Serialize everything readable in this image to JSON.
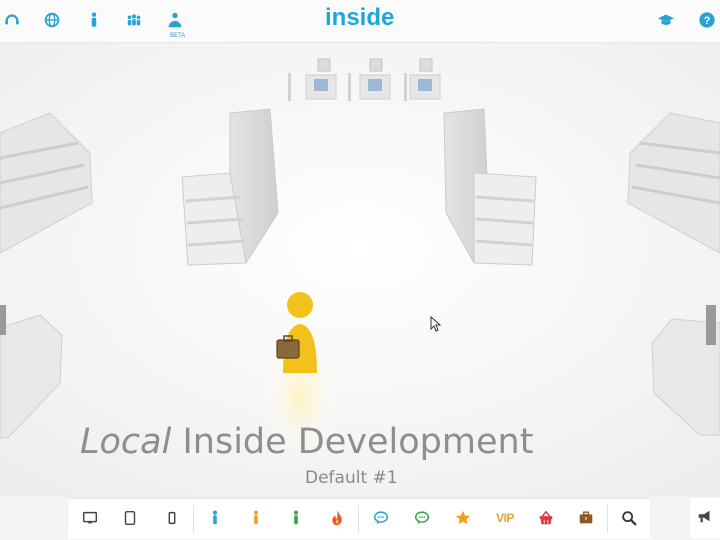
{
  "header": {
    "logo": "inside",
    "beta_label": "BETA",
    "left_icons": [
      "headset-icon",
      "globe-icon",
      "visitor-icon",
      "group-icon",
      "agent-icon"
    ],
    "right_icons": [
      "graduation-cap-icon",
      "help-icon"
    ]
  },
  "scene": {
    "title_italic": "Local",
    "title_rest": " Inside Development",
    "subtitle": "Default #1"
  },
  "toolbar": {
    "groups": [
      [
        "desktop-icon",
        "tablet-icon",
        "mobile-icon"
      ],
      [
        "person-blue-icon",
        "person-orange-icon",
        "person-green-icon",
        "fire-icon"
      ],
      [
        "chat-blue-icon",
        "chat-green-icon",
        "star-icon",
        "vip-label",
        "basket-icon",
        "briefcase-icon"
      ],
      [
        "search-icon"
      ]
    ],
    "vip_label": "VIP"
  },
  "colors": {
    "accent": "#27a3d4",
    "logo": "#1ea7db",
    "avatar": "#f2c21b",
    "background": "#f4f4f4"
  }
}
